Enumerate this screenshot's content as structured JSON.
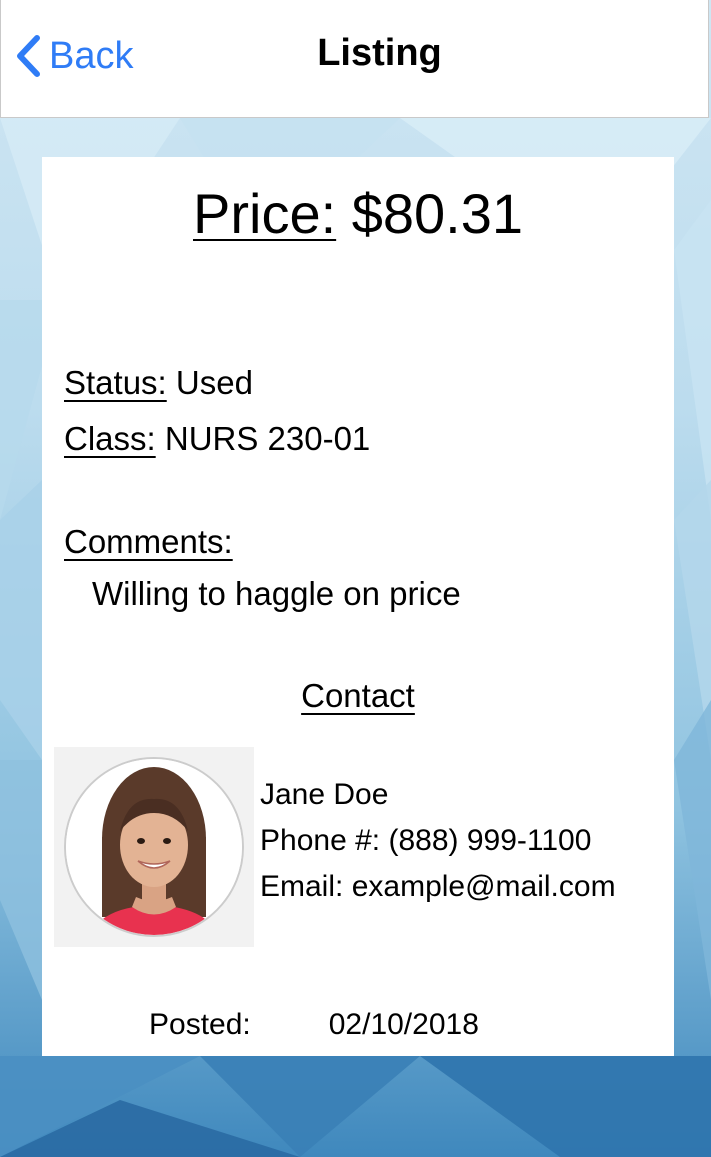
{
  "nav": {
    "back_label": "Back",
    "title": "Listing",
    "accent_color": "#2f7cf6"
  },
  "listing": {
    "price_label": "Price:",
    "price_value": "$80.31",
    "status_label": "Status:",
    "status_value": "Used",
    "class_label": "Class:",
    "class_value": "NURS 230-01",
    "comments_label": "Comments:",
    "comments_value": "Willing to haggle on price"
  },
  "contact": {
    "heading": "Contact",
    "name": "Jane Doe",
    "phone_label": "Phone #:",
    "phone_value": "(888) 999-1100",
    "email_label": "Email:",
    "email_value": "example@mail.com",
    "avatar_icon": "person-photo"
  },
  "posted": {
    "label": "Posted:",
    "date": "02/10/2018"
  }
}
